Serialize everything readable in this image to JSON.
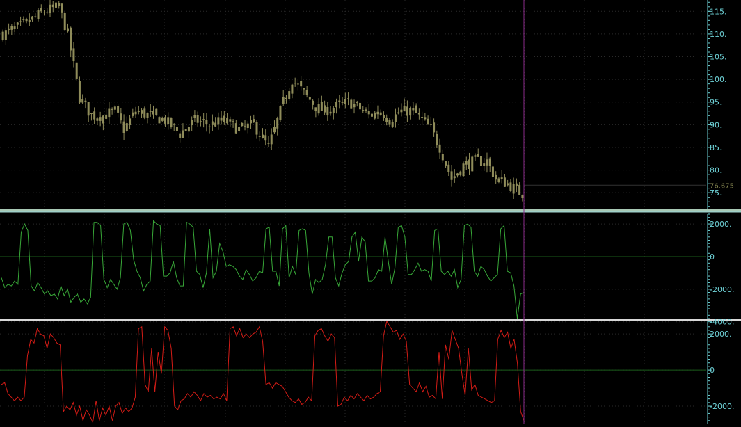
{
  "chart_data": [
    {
      "type": "candlestick",
      "ylim": [
        71.5,
        117.5
      ],
      "y_ticks": [
        "75.",
        "80.",
        "85.",
        "90.",
        "95.",
        "100.",
        "105.",
        "110.",
        "115."
      ],
      "last_price_label": "76.675",
      "last_price": 76.675,
      "grid": true,
      "colors": {
        "candle": "#8f8c5a",
        "axis_label": "#6fd3d8",
        "last_price": "#8a8a52"
      },
      "close_path": [
        [
          0,
          110
        ],
        [
          7,
          112
        ],
        [
          14,
          115
        ],
        [
          19,
          116
        ],
        [
          22,
          110
        ],
        [
          26,
          96
        ],
        [
          30,
          92
        ],
        [
          34,
          92
        ],
        [
          38,
          93
        ],
        [
          41,
          89
        ],
        [
          45,
          93
        ],
        [
          50,
          92
        ],
        [
          55,
          91
        ],
        [
          60,
          88
        ],
        [
          65,
          91
        ],
        [
          70,
          90
        ],
        [
          75,
          91
        ],
        [
          80,
          89
        ],
        [
          85,
          90
        ],
        [
          90,
          85
        ],
        [
          95,
          95
        ],
        [
          98,
          100
        ],
        [
          102,
          97
        ],
        [
          106,
          94
        ],
        [
          109,
          93
        ],
        [
          113,
          94
        ],
        [
          117,
          95
        ],
        [
          120,
          94
        ],
        [
          124,
          92
        ],
        [
          128,
          93
        ],
        [
          131,
          91
        ],
        [
          135,
          93
        ],
        [
          139,
          93
        ],
        [
          142,
          91
        ],
        [
          145,
          89
        ],
        [
          148,
          85
        ],
        [
          152,
          78
        ],
        [
          156,
          81
        ],
        [
          160,
          82
        ],
        [
          164,
          82
        ],
        [
          167,
          78
        ],
        [
          171,
          77
        ],
        [
          175,
          75
        ],
        [
          177,
          76
        ]
      ],
      "candle_count": 177,
      "candle_seed": 7
    },
    {
      "type": "line",
      "ylim": [
        -3800,
        2600
      ],
      "y_ticks": [
        "2000.",
        "0",
        "-2000.",
        "-4000."
      ],
      "y_tick_values": [
        2000,
        0,
        -2000,
        -4000
      ],
      "zero_line": true,
      "colors": {
        "line": "#38a838",
        "zero": "#1a5c1a",
        "axis_label": "#6fd3d8"
      },
      "values": [
        -1300,
        -1900,
        -1700,
        -1800,
        -1500,
        -1700,
        1500,
        2000,
        1600,
        -1800,
        -2100,
        -1600,
        -1900,
        -2300,
        -2100,
        -2400,
        -2300,
        -2600,
        -1800,
        -2400,
        -2000,
        -2800,
        -2500,
        -2300,
        -2800,
        -2600,
        -2900,
        -2500,
        2100,
        2100,
        1900,
        -1400,
        -1900,
        -1400,
        -1700,
        -2000,
        -1300,
        2000,
        2100,
        1600,
        -200,
        -900,
        -1300,
        -2100,
        -1700,
        -1500,
        2200,
        2000,
        1900,
        -1200,
        -1200,
        -1000,
        -300,
        -1300,
        -1800,
        -1800,
        2100,
        2000,
        1800,
        -900,
        -1100,
        -1900,
        -1000,
        1700,
        -1300,
        -900,
        800,
        300,
        -600,
        -500,
        -600,
        -800,
        -1200,
        -1400,
        -800,
        -1100,
        -1500,
        -1300,
        -900,
        -1000,
        1700,
        1800,
        -900,
        -900,
        -1800,
        1700,
        1900,
        -1300,
        -600,
        -1100,
        1600,
        1700,
        1600,
        -1000,
        -2300,
        -1400,
        -1600,
        -1400,
        -500,
        1200,
        1200,
        -1300,
        -1800,
        -1000,
        -500,
        -300,
        1200,
        1500,
        -300,
        1200,
        900,
        -1500,
        -1500,
        -1300,
        -800,
        -900,
        1200,
        -300,
        -1700,
        -700,
        1800,
        1900,
        1200,
        -1100,
        -1100,
        -800,
        -400,
        -900,
        -800,
        -900,
        -1500,
        1600,
        1700,
        -900,
        -1100,
        -900,
        -1200,
        -800,
        -1900,
        -1400,
        1900,
        2000,
        1800,
        -900,
        -1200,
        -600,
        -800,
        -1200,
        -1500,
        -1300,
        -1100,
        1700,
        1900,
        -900,
        -1000,
        -1800,
        -3800,
        -2300,
        -2200
      ],
      "highlight_value": -3800
    },
    {
      "type": "line",
      "ylim": [
        -3000,
        2700
      ],
      "y_ticks": [
        "2000.",
        "0",
        "-2000."
      ],
      "y_tick_values": [
        2000,
        0,
        -2000
      ],
      "zero_line": true,
      "colors": {
        "line": "#d41c16",
        "zero": "#1a5c1a",
        "axis_label": "#6fd3d8"
      },
      "values": [
        -800,
        -700,
        -1300,
        -1500,
        -1700,
        -1500,
        -1700,
        -1500,
        800,
        1700,
        1500,
        2300,
        2000,
        1900,
        1200,
        2000,
        1800,
        1500,
        1400,
        -2300,
        -2000,
        -2200,
        -1800,
        -2500,
        -2000,
        -2800,
        -2200,
        -2500,
        -2900,
        -1700,
        -2800,
        -2100,
        -2500,
        -2000,
        -2800,
        -2000,
        -1800,
        -2400,
        -2100,
        -2300,
        -2100,
        -1500,
        2300,
        2400,
        -800,
        -1200,
        1200,
        -1200,
        1000,
        -200,
        2400,
        2200,
        1200,
        -2000,
        -2200,
        -1700,
        -1600,
        -1300,
        -1500,
        -1200,
        -1400,
        -1700,
        -1300,
        -1500,
        -1400,
        -1600,
        -1500,
        -1600,
        -1300,
        -1700,
        2300,
        2400,
        1900,
        2300,
        1800,
        2000,
        1800,
        2000,
        2100,
        2400,
        1600,
        -800,
        -700,
        -1000,
        -700,
        -800,
        -900,
        -1200,
        -1500,
        -1700,
        -1800,
        -1600,
        -1900,
        -1800,
        -1500,
        -1700,
        1900,
        2200,
        2300,
        1900,
        1600,
        2000,
        1800,
        -2000,
        -1900,
        -1500,
        -1700,
        -1400,
        -1600,
        -1300,
        -1500,
        -1700,
        -1400,
        -1600,
        -1500,
        -1300,
        -1200,
        1900,
        2700,
        2400,
        2100,
        2200,
        1700,
        2000,
        1600,
        -800,
        -1000,
        -1200,
        -700,
        -1200,
        -900,
        -1500,
        -1400,
        -1600,
        1000,
        -1600,
        1400,
        600,
        2200,
        1700,
        1200,
        -200,
        -1400,
        1200,
        -1100,
        -800,
        -1400,
        -1500,
        -1600,
        -1700,
        -1800,
        -1700,
        1700,
        2200,
        1800,
        2100,
        1200,
        1700,
        400,
        -2300,
        -2800
      ],
      "highlight_value": -2800
    }
  ]
}
